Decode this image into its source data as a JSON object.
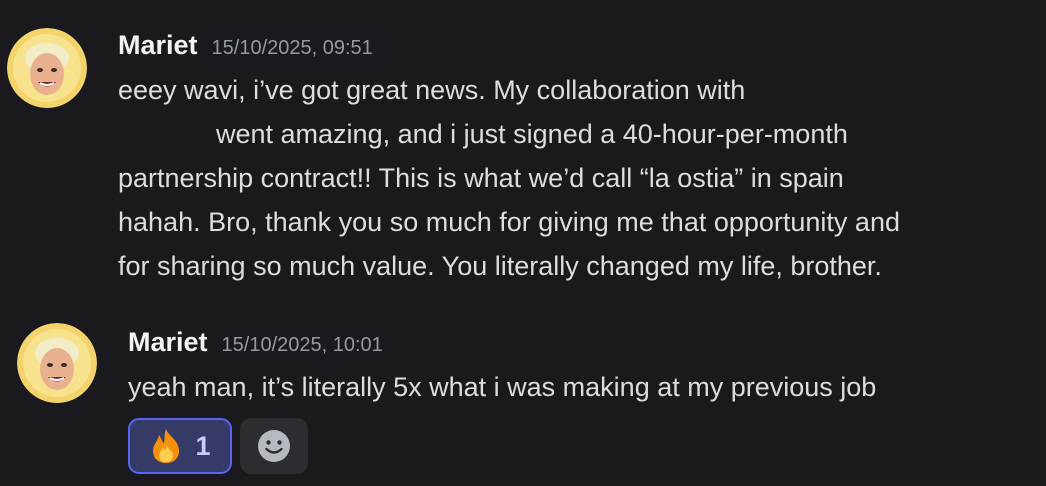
{
  "messages": [
    {
      "author": "Mariet",
      "timestamp": "15/10/2025, 09:51",
      "lines": [
        "eeey wavi, i’ve got great news. My collaboration with",
        "went amazing, and i just signed a 40-hour-per-month",
        "partnership contract!! This is what we’d call “la ostia” in spain",
        "hahah. Bro, thank you so much for giving me that opportunity and",
        "for sharing so much value. You literally changed my life, brother."
      ]
    },
    {
      "author": "Mariet",
      "timestamp": "15/10/2025, 10:01",
      "lines": [
        "yeah man, it’s literally 5x what i was making at my previous job"
      ],
      "reactions": [
        {
          "icon": "fire-emoji",
          "count": "1",
          "active": true
        }
      ],
      "add_reaction_icon": "add-reaction-smiley-icon"
    }
  ],
  "colors": {
    "background": "#1a1a1e",
    "author": "#f2f3f5",
    "timestamp": "#949ba4",
    "text": "#dbdee1",
    "reaction_active_bg": "#363a66",
    "reaction_active_border": "#5865f2"
  }
}
